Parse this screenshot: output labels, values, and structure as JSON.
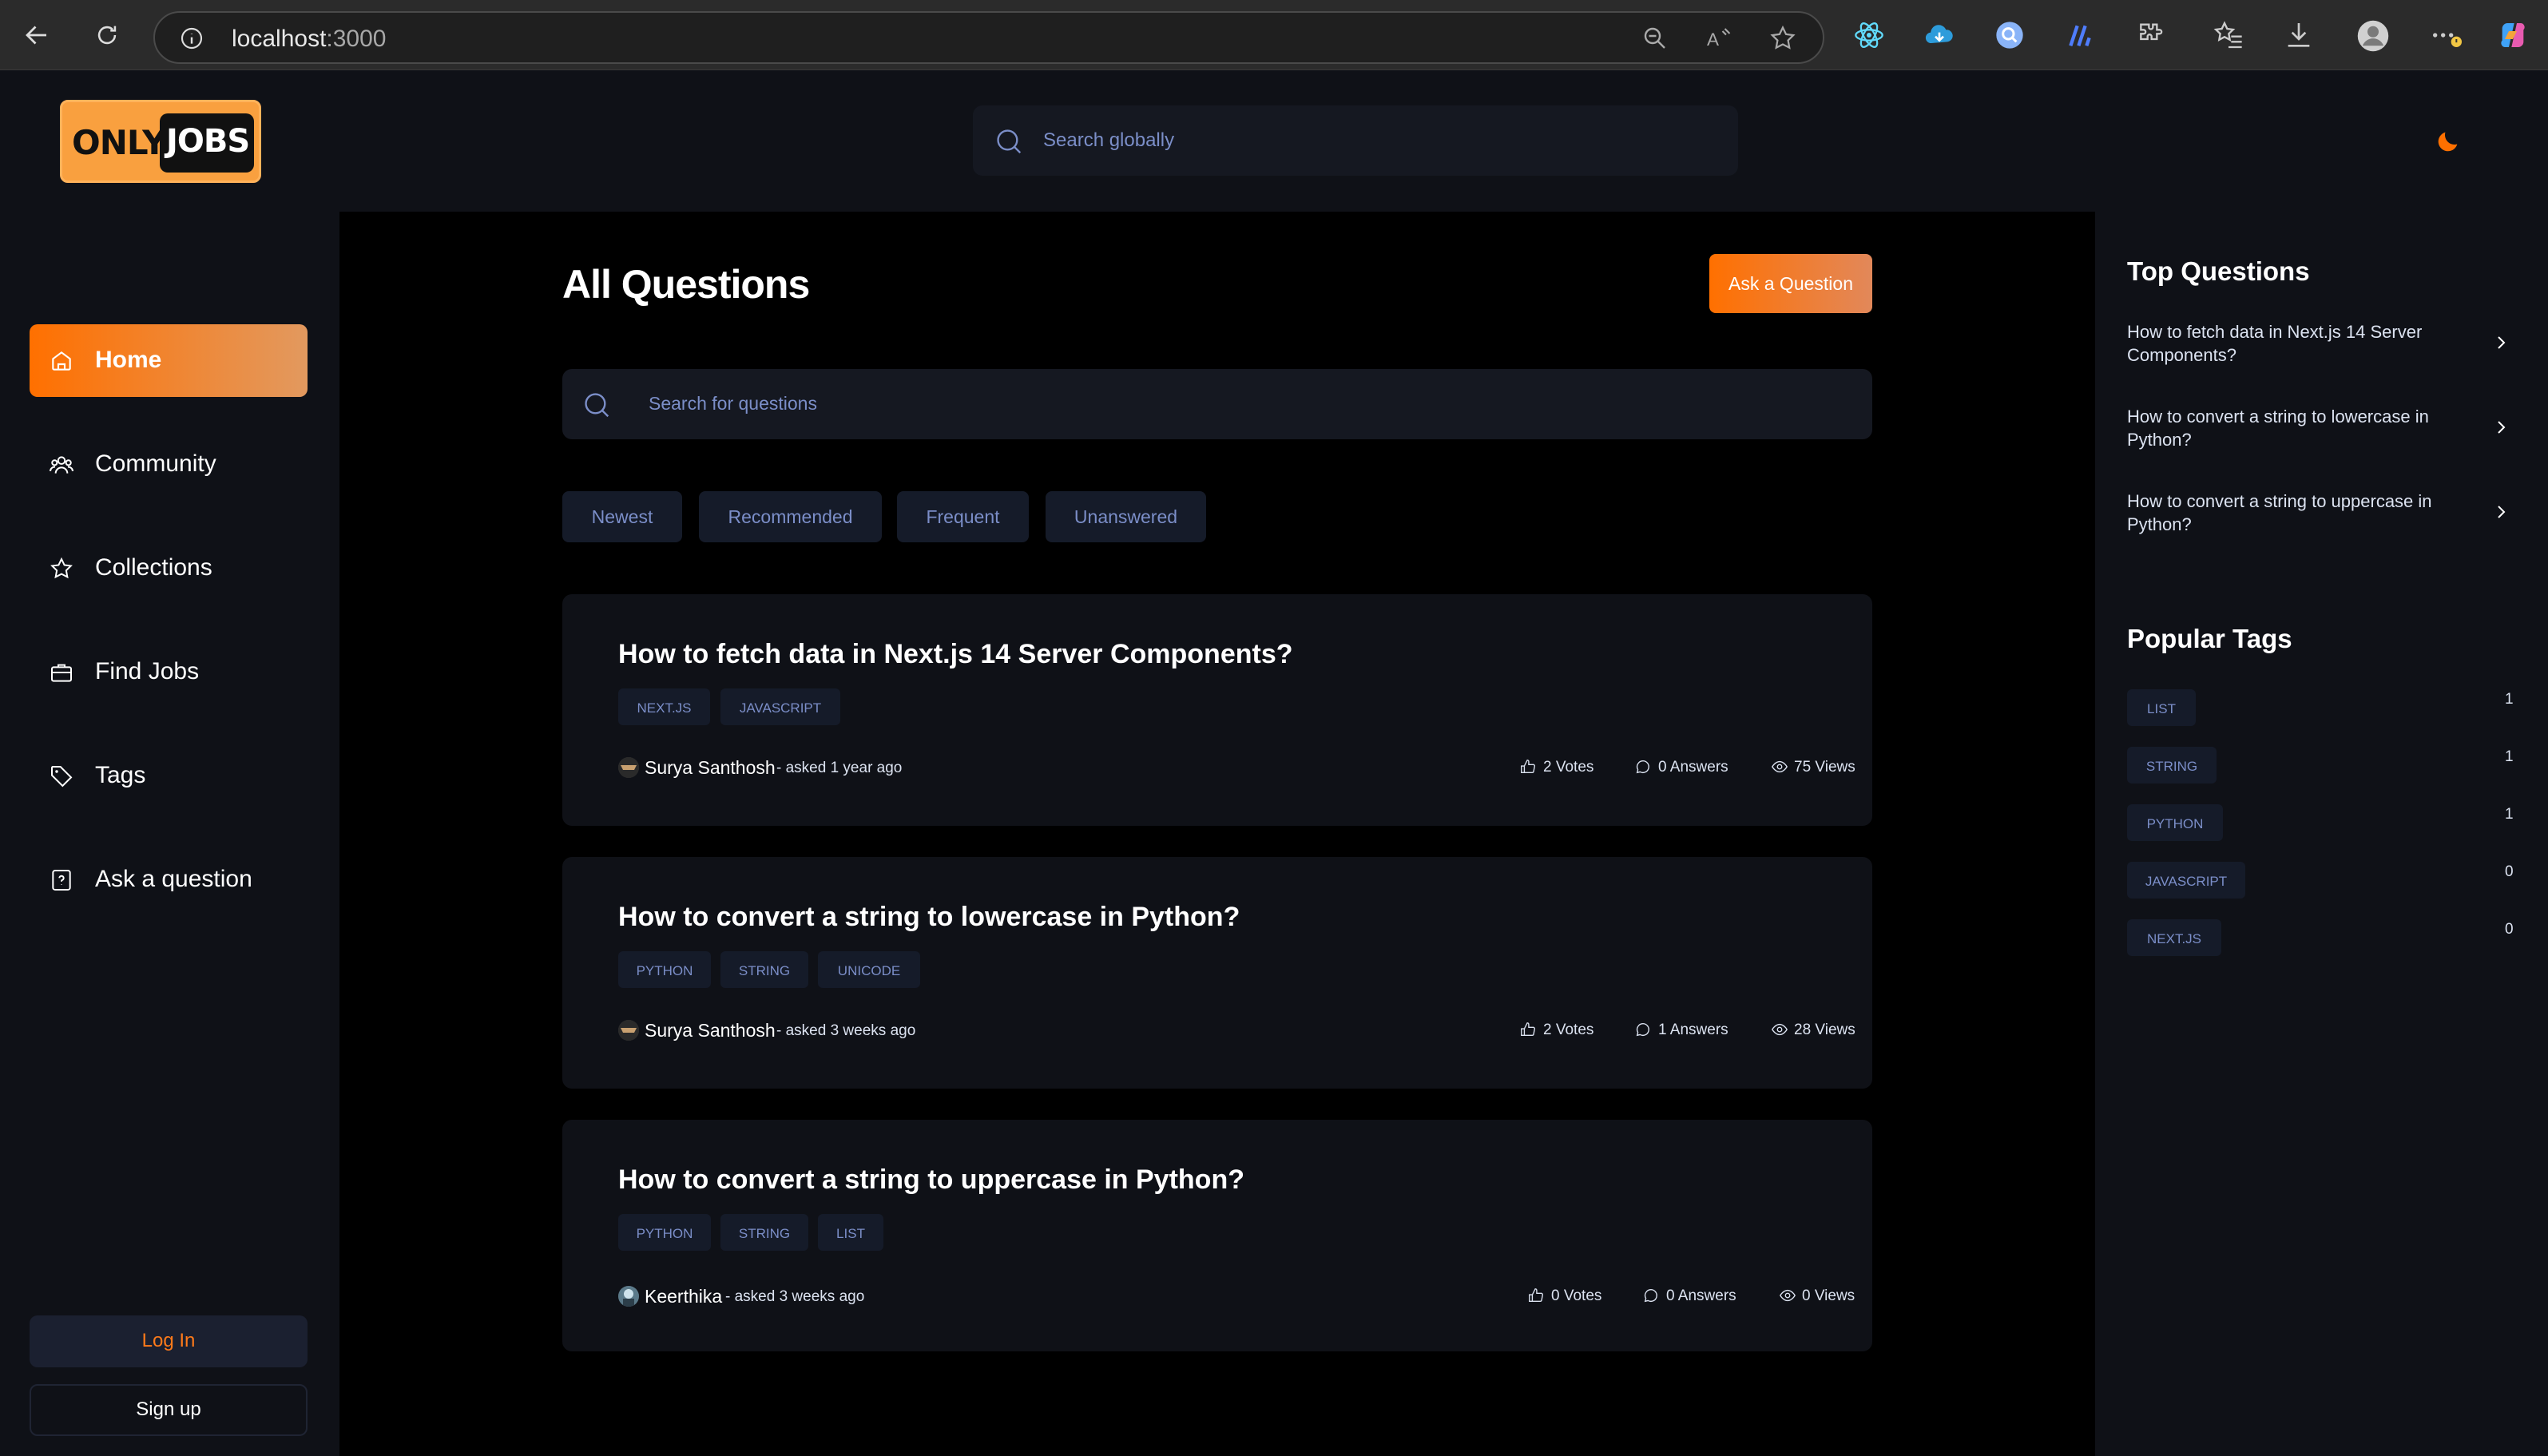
{
  "browser": {
    "url_host": "localhost",
    "url_port": ":3000"
  },
  "header": {
    "logo_only": "ONLY",
    "logo_jobs": "JOBS",
    "global_search_placeholder": "Search globally"
  },
  "sidebar": {
    "items": [
      {
        "label": "Home",
        "icon": "home-icon",
        "active": true
      },
      {
        "label": "Community",
        "icon": "users-icon"
      },
      {
        "label": "Collections",
        "icon": "star-icon"
      },
      {
        "label": "Find Jobs",
        "icon": "suitcase-icon"
      },
      {
        "label": "Tags",
        "icon": "tag-icon"
      },
      {
        "label": "Ask a question",
        "icon": "question-icon"
      }
    ],
    "login_label": "Log In",
    "signup_label": "Sign up"
  },
  "main": {
    "title": "All Questions",
    "ask_button": "Ask a Question",
    "search_placeholder": "Search for questions",
    "filters": [
      "Newest",
      "Recommended",
      "Frequent",
      "Unanswered"
    ],
    "questions": [
      {
        "title": "How to fetch data in Next.js 14 Server Components?",
        "tags": [
          "NEXT.JS",
          "JAVASCRIPT"
        ],
        "author": "Surya Santhosh",
        "asked": " - asked 1 year ago",
        "votes": "2 Votes",
        "answers": "0 Answers",
        "views": "75 Views"
      },
      {
        "title": "How to convert a string to lowercase in Python?",
        "tags": [
          "PYTHON",
          "STRING",
          "UNICODE"
        ],
        "author": "Surya Santhosh",
        "asked": " - asked 3 weeks ago",
        "votes": "2 Votes",
        "answers": "1 Answers",
        "views": "28 Views"
      },
      {
        "title": "How to convert a string to uppercase in Python?",
        "tags": [
          "PYTHON",
          "STRING",
          "LIST"
        ],
        "author": "Keerthika",
        "asked": " - asked 3 weeks ago",
        "votes": "0 Votes",
        "answers": "0 Answers",
        "views": "0 Views"
      }
    ]
  },
  "right": {
    "top_questions_heading": "Top Questions",
    "top_questions": [
      "How to fetch data in Next.js 14 Server Components?",
      "How to convert a string to lowercase in Python?",
      "How to convert a string to uppercase in Python?"
    ],
    "popular_tags_heading": "Popular Tags",
    "popular_tags": [
      {
        "name": "LIST",
        "count": "1"
      },
      {
        "name": "STRING",
        "count": "1"
      },
      {
        "name": "PYTHON",
        "count": "1"
      },
      {
        "name": "JAVASCRIPT",
        "count": "0"
      },
      {
        "name": "NEXT.JS",
        "count": "0"
      }
    ]
  },
  "colors": {
    "accent": "#ff7000",
    "background": "#000000",
    "panel": "#0f1117",
    "tag_text": "#7b8ec8"
  }
}
